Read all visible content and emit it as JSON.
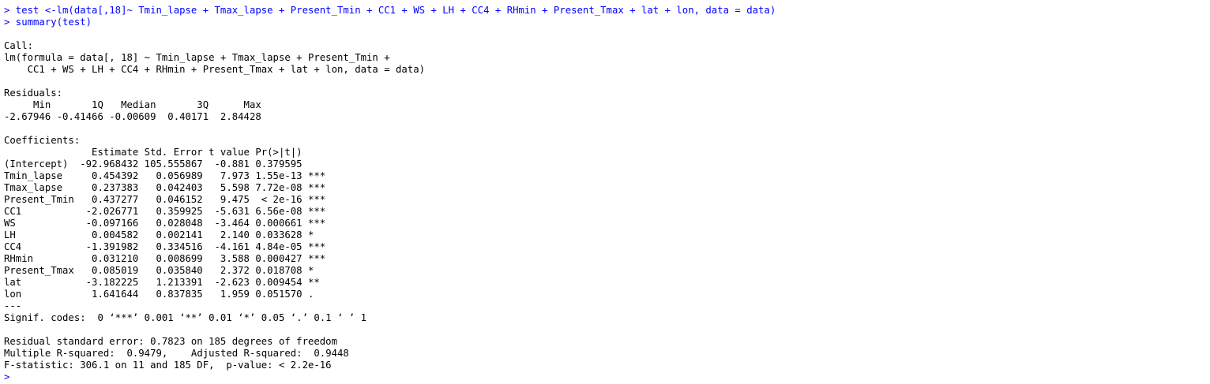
{
  "console": {
    "commands": [
      "> test <-lm(data[,18]~ Tmin_lapse + Tmax_lapse + Present_Tmin + CC1 + WS + LH + CC4 + RHmin + Present_Tmax + lat + lon, data = data)",
      "> summary(test)"
    ],
    "call": {
      "header": "Call:",
      "line1": "lm(formula = data[, 18] ~ Tmin_lapse + Tmax_lapse + Present_Tmin +",
      "line2": "    CC1 + WS + LH + CC4 + RHmin + Present_Tmax + lat + lon, data = data)"
    },
    "residuals": {
      "header": "Residuals:",
      "labels": "     Min       1Q   Median       3Q      Max ",
      "values": "-2.67946 -0.41466 -0.00609  0.40171  2.84428 "
    },
    "coefficients": {
      "header": "Coefficients:",
      "column_header": "               Estimate Std. Error t value Pr(>|t|)    ",
      "rows": [
        {
          "term": "(Intercept)",
          "line": "(Intercept)  -92.968432 105.555867  -0.881 0.379595    "
        },
        {
          "term": "Tmin_lapse",
          "line": "Tmin_lapse     0.454392   0.056989   7.973 1.55e-13 ***"
        },
        {
          "term": "Tmax_lapse",
          "line": "Tmax_lapse     0.237383   0.042403   5.598 7.72e-08 ***"
        },
        {
          "term": "Present_Tmin",
          "line": "Present_Tmin   0.437277   0.046152   9.475  < 2e-16 ***"
        },
        {
          "term": "CC1",
          "line": "CC1           -2.026771   0.359925  -5.631 6.56e-08 ***"
        },
        {
          "term": "WS",
          "line": "WS            -0.097166   0.028048  -3.464 0.000661 ***"
        },
        {
          "term": "LH",
          "line": "LH             0.004582   0.002141   2.140 0.033628 *  "
        },
        {
          "term": "CC4",
          "line": "CC4           -1.391982   0.334516  -4.161 4.84e-05 ***"
        },
        {
          "term": "RHmin",
          "line": "RHmin          0.031210   0.008699   3.588 0.000427 ***"
        },
        {
          "term": "Present_Tmax",
          "line": "Present_Tmax   0.085019   0.035840   2.372 0.018708 *  "
        },
        {
          "term": "lat",
          "line": "lat           -3.182225   1.213391  -2.623 0.009454 ** "
        },
        {
          "term": "lon",
          "line": "lon            1.641644   0.837835   1.959 0.051570 .  "
        }
      ],
      "separator": "---",
      "signif_codes": "Signif. codes:  0 ‘***’ 0.001 ‘**’ 0.01 ‘*’ 0.05 ‘.’ 0.1 ‘ ’ 1"
    },
    "fit": {
      "residual_se": "Residual standard error: 0.7823 on 185 degrees of freedom",
      "r_squared": "Multiple R-squared:  0.9479,\tAdjusted R-squared:  0.9448 ",
      "f_statistic": "F-statistic: 306.1 on 11 and 185 DF,  p-value: < 2.2e-16"
    },
    "prompt": ">"
  },
  "colors": {
    "command_text": "#0000ff",
    "output_text": "#000000",
    "background": "#ffffff"
  }
}
